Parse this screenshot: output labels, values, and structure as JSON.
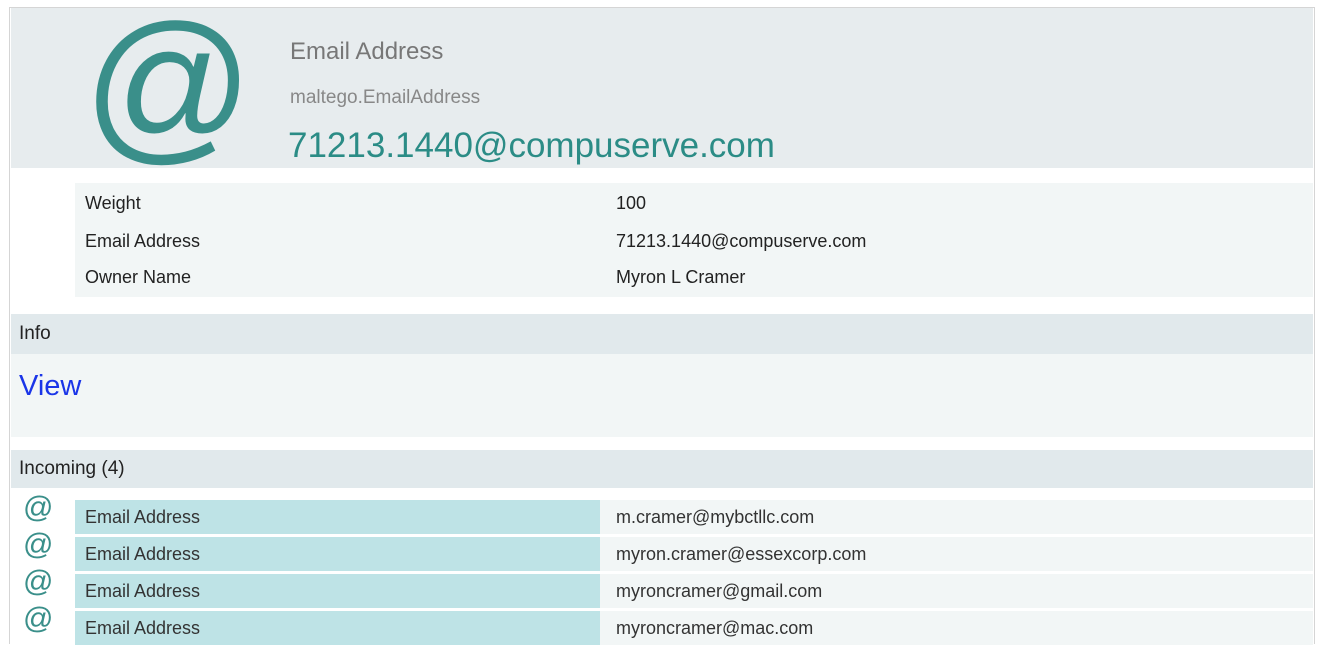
{
  "header": {
    "icon": "at-sign-icon",
    "type_name": "Email Address",
    "type_id": "maltego.EmailAddress",
    "value": "71213.1440@compuserve.com"
  },
  "properties": [
    {
      "key": "Weight",
      "value": "100"
    },
    {
      "key": "Email Address",
      "value": "71213.1440@compuserve.com"
    },
    {
      "key": "Owner Name",
      "value": "Myron L Cramer"
    }
  ],
  "info": {
    "label": "Info",
    "view_link": "View"
  },
  "incoming": {
    "label": "Incoming (4)",
    "items": [
      {
        "icon": "at-sign-icon",
        "type": "Email Address",
        "value": "m.cramer@mybctllc.com"
      },
      {
        "icon": "at-sign-icon",
        "type": "Email Address",
        "value": "myron.cramer@essexcorp.com"
      },
      {
        "icon": "at-sign-icon",
        "type": "Email Address",
        "value": "myroncramer@gmail.com"
      },
      {
        "icon": "at-sign-icon",
        "type": "Email Address",
        "value": "myroncramer@mac.com"
      }
    ]
  },
  "colors": {
    "accent": "#2b8c86",
    "link": "#1a35e8",
    "header_bg": "#e7ecee",
    "incoming_type_bg": "#bee3e6"
  }
}
